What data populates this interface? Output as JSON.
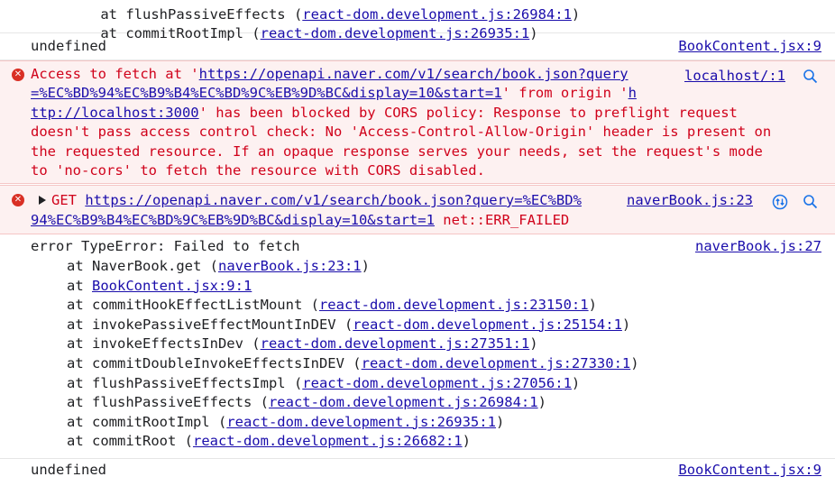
{
  "top_trace": {
    "partial_line": {
      "prefix": "at flushPassiveEffects (",
      "link": "react-dom.development.js:26984:1",
      "suffix": ")"
    },
    "line": {
      "prefix": "at commitRootImpl (",
      "link": "react-dom.development.js:26935:1",
      "suffix": ")"
    }
  },
  "log1": {
    "text": "undefined",
    "source": "BookContent.jsx:9"
  },
  "cors_error": {
    "source": "localhost/:1",
    "l1_a": "Access to fetch at '",
    "l1_link": "https://openapi.naver.com/v1/search/book.json?query",
    "l2_link": "=%EC%BD%94%EC%B9%B4%EC%BD%9C%EB%9D%BC&display=10&start=1",
    "l2_b": "' from origin '",
    "l2_link2": "h",
    "l3_link": "ttp://localhost:3000",
    "l3_b": "' has been blocked by CORS policy: Response to preflight request",
    "l4": "doesn't pass access control check: No 'Access-Control-Allow-Origin' header is present on",
    "l5": "the requested resource. If an opaque response serves your needs, set the request's mode",
    "l6": "to 'no-cors' to fetch the resource with CORS disabled."
  },
  "get_error": {
    "method": "GET",
    "url1": "https://openapi.naver.com/v1/search/book.json?query=%EC%BD%",
    "url2": "94%EC%B9%B4%EC%BD%9C%EB%9D%BC&display=10&start=1",
    "status": "net::ERR_FAILED",
    "source": "naverBook.js:23"
  },
  "type_error": {
    "header": "error TypeError: Failed to fetch",
    "source": "naverBook.js:27",
    "frames": [
      {
        "prefix": "at NaverBook.get (",
        "link": "naverBook.js:23:1",
        "suffix": ")"
      },
      {
        "prefix": "at ",
        "link": "BookContent.jsx:9:1",
        "suffix": ""
      },
      {
        "prefix": "at commitHookEffectListMount (",
        "link": "react-dom.development.js:23150:1",
        "suffix": ")"
      },
      {
        "prefix": "at invokePassiveEffectMountInDEV (",
        "link": "react-dom.development.js:25154:1",
        "suffix": ")"
      },
      {
        "prefix": "at invokeEffectsInDev (",
        "link": "react-dom.development.js:27351:1",
        "suffix": ")"
      },
      {
        "prefix": "at commitDoubleInvokeEffectsInDEV (",
        "link": "react-dom.development.js:27330:1",
        "suffix": ")"
      },
      {
        "prefix": "at flushPassiveEffectsImpl (",
        "link": "react-dom.development.js:27056:1",
        "suffix": ")"
      },
      {
        "prefix": "at flushPassiveEffects (",
        "link": "react-dom.development.js:26984:1",
        "suffix": ")"
      },
      {
        "prefix": "at commitRootImpl (",
        "link": "react-dom.development.js:26935:1",
        "suffix": ")"
      },
      {
        "prefix": "at commitRoot (",
        "link": "react-dom.development.js:26682:1",
        "suffix": ")"
      }
    ]
  },
  "log2": {
    "text": "undefined",
    "source": "BookContent.jsx:9"
  },
  "icons": {
    "error": "error-circle-icon",
    "search": "magnifier-icon",
    "network": "network-request-icon",
    "expand": "expand-triangle-icon"
  }
}
